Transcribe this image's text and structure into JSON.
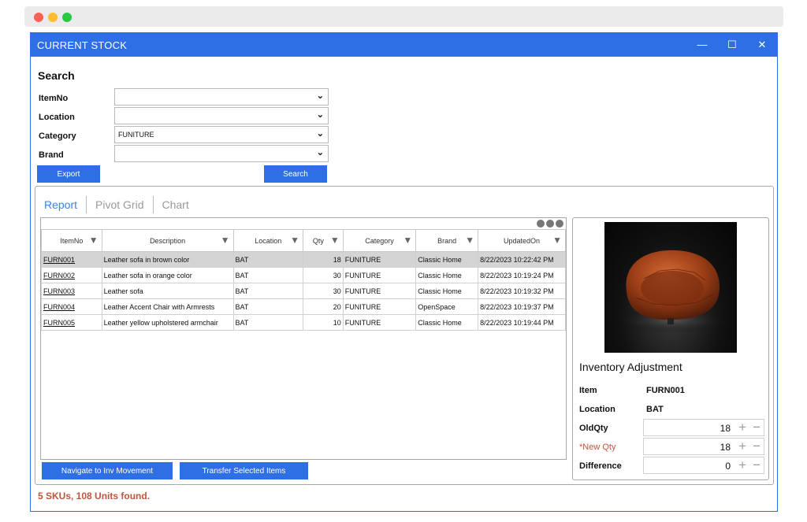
{
  "window": {
    "title": "CURRENT STOCK",
    "controls": {
      "minimize": "—",
      "maximize": "☐",
      "close": "✕"
    }
  },
  "search": {
    "title": "Search",
    "fields": [
      {
        "label": "ItemNo",
        "value": ""
      },
      {
        "label": "Location",
        "value": ""
      },
      {
        "label": "Category",
        "value": "FUNITURE"
      },
      {
        "label": "Brand",
        "value": ""
      }
    ],
    "export_label": "Export",
    "search_label": "Search"
  },
  "tabs": [
    "Report",
    "Pivot Grid",
    "Chart"
  ],
  "grid": {
    "columns": [
      "ItemNo",
      "Description",
      "Location",
      "Qty",
      "Category",
      "Brand",
      "UpdatedOn"
    ],
    "rows": [
      [
        "FURN001",
        "Leather sofa in brown color",
        "BAT",
        "18",
        "FUNITURE",
        "Classic Home",
        "8/22/2023 10:22:42 PM"
      ],
      [
        "FURN002",
        "Leather sofa in orange color",
        "BAT",
        "30",
        "FUNITURE",
        "Classic Home",
        "8/22/2023 10:19:24 PM"
      ],
      [
        "FURN003",
        "Leather sofa",
        "BAT",
        "30",
        "FUNITURE",
        "Classic Home",
        "8/22/2023 10:19:32 PM"
      ],
      [
        "FURN004",
        "Leather Accent Chair with Armrests",
        "BAT",
        "20",
        "FUNITURE",
        "OpenSpace",
        "8/22/2023 10:19:37 PM"
      ],
      [
        "FURN005",
        "Leather yellow upholstered armchair",
        "BAT",
        "10",
        "FUNITURE",
        "Classic Home",
        "8/22/2023 10:19:44 PM"
      ]
    ]
  },
  "actions": {
    "navigate_label": "Navigate to Inv Movement",
    "transfer_label": "Transfer Selected Items"
  },
  "adjustment": {
    "title": "Inventory Adjustment",
    "item_label": "Item",
    "item_value": "FURN001",
    "location_label": "Location",
    "location_value": "BAT",
    "oldqty_label": "OldQty",
    "oldqty_value": "18",
    "newqty_label": "*New Qty",
    "newqty_value": "18",
    "difference_label": "Difference",
    "difference_value": "0"
  },
  "status": "5 SKUs, 108 Units found.",
  "colors": {
    "accent": "#2f6fe6",
    "status": "#c0553f",
    "selected_row": "#d4d4d4"
  }
}
